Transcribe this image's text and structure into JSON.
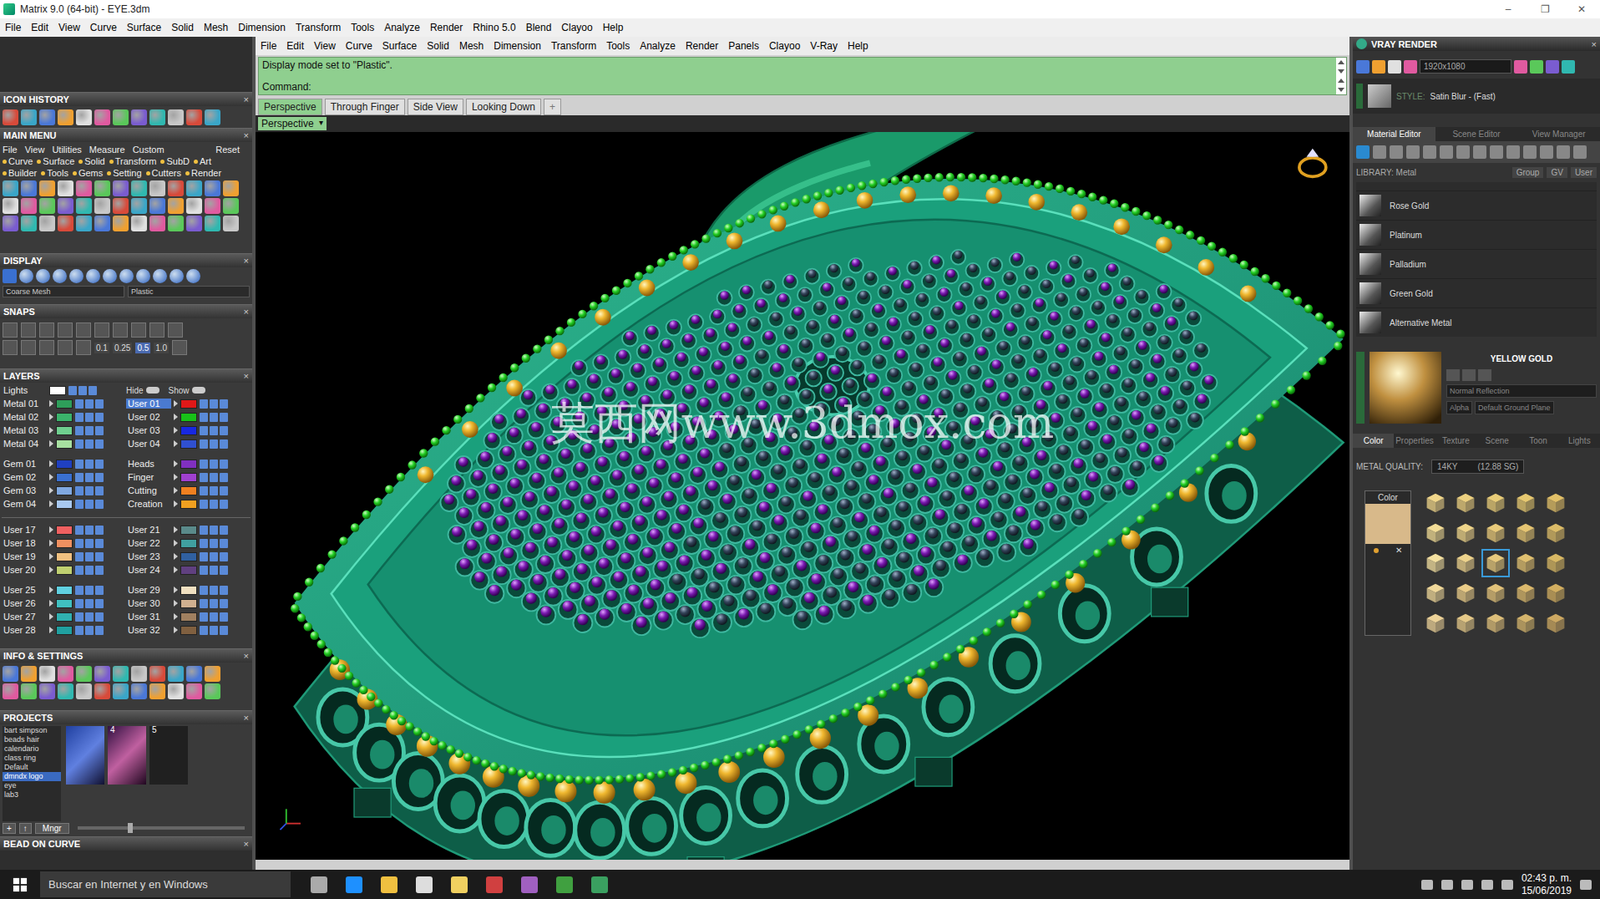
{
  "window": {
    "title": "Matrix 9.0 (64-bit) - EYE.3dm",
    "controls": [
      "–",
      "❐",
      "✕"
    ]
  },
  "menubar": [
    "File",
    "Edit",
    "View",
    "Curve",
    "Surface",
    "Solid",
    "Mesh",
    "Dimension",
    "Transform",
    "Tools",
    "Analyze",
    "Render",
    "Rhino 5.0",
    "Blend",
    "Clayoo",
    "Help"
  ],
  "panel_close": "×",
  "icon_history": {
    "title": "ICON HISTORY"
  },
  "main_menu": {
    "title": "MAIN MENU",
    "menus": [
      "File",
      "View",
      "Utilities",
      "Measure",
      "Custom"
    ],
    "reset": "Reset",
    "categories": [
      [
        "Curve",
        "Surface",
        "Solid",
        "Transform",
        "SubD",
        "Art"
      ],
      [
        "Builder",
        "Tools",
        "Gems",
        "Setting",
        "Cutters",
        "Render"
      ]
    ]
  },
  "display": {
    "title": "DISPLAY",
    "mesh": "Coarse Mesh",
    "mode": "Plastic"
  },
  "snaps": {
    "title": "SNAPS",
    "values": [
      {
        "label": "0.1",
        "selected": false
      },
      {
        "label": "0.25",
        "selected": false
      },
      {
        "label": "0.5",
        "selected": true
      },
      {
        "label": "1.0",
        "selected": false
      }
    ]
  },
  "layers": {
    "title": "LAYERS",
    "lights": "Lights",
    "hide": "Hide",
    "show": "Show",
    "groups": [
      [
        [
          {
            "name": "Metal 01",
            "color": "#2e9e5a",
            "selected": false
          },
          {
            "name": "User 01",
            "color": "#e01818",
            "selected": true
          }
        ],
        [
          {
            "name": "Metal 02",
            "color": "#3bb36b",
            "selected": false
          },
          {
            "name": "User 02",
            "color": "#18c018",
            "selected": false
          }
        ],
        [
          {
            "name": "Metal 03",
            "color": "#6fcf8f",
            "selected": false
          },
          {
            "name": "User 03",
            "color": "#1828e0",
            "selected": false
          }
        ],
        [
          {
            "name": "Metal 04",
            "color": "#a7e0a0",
            "selected": false
          },
          {
            "name": "User 04",
            "color": "#3050d0",
            "selected": false
          }
        ]
      ],
      [
        [
          {
            "name": "Gem 01",
            "color": "#2040c0",
            "selected": false
          },
          {
            "name": "Heads",
            "color": "#8030c0",
            "selected": false
          }
        ],
        [
          {
            "name": "Gem 02",
            "color": "#3a70d0",
            "selected": false
          },
          {
            "name": "Finger",
            "color": "#a040d0",
            "selected": false
          }
        ],
        [
          {
            "name": "Gem 03",
            "color": "#80a8e0",
            "selected": false
          },
          {
            "name": "Cutting",
            "color": "#f08020",
            "selected": false
          }
        ],
        [
          {
            "name": "Gem 04",
            "color": "#a8c8f0",
            "selected": false
          },
          {
            "name": "Creation",
            "color": "#f0a020",
            "selected": false
          }
        ]
      ],
      [
        [
          {
            "name": "User 17",
            "color": "#f06060",
            "selected": false
          },
          {
            "name": "User 21",
            "color": "#5a8a8a",
            "selected": false
          }
        ],
        [
          {
            "name": "User 18",
            "color": "#f09060",
            "selected": false
          },
          {
            "name": "User 22",
            "color": "#40a0a0",
            "selected": false
          }
        ],
        [
          {
            "name": "User 19",
            "color": "#f0c080",
            "selected": false
          },
          {
            "name": "User 23",
            "color": "#3060a0",
            "selected": false
          }
        ],
        [
          {
            "name": "User 20",
            "color": "#c0d070",
            "selected": false
          },
          {
            "name": "User 24",
            "color": "#604080",
            "selected": false
          }
        ]
      ],
      [
        [
          {
            "name": "User 25",
            "color": "#60d0e0",
            "selected": false
          },
          {
            "name": "User 29",
            "color": "#f0e0c0",
            "selected": false
          }
        ],
        [
          {
            "name": "User 26",
            "color": "#40c0c0",
            "selected": false
          },
          {
            "name": "User 30",
            "color": "#d0b090",
            "selected": false
          }
        ],
        [
          {
            "name": "User 27",
            "color": "#30b0b0",
            "selected": false
          },
          {
            "name": "User 31",
            "color": "#a08060",
            "selected": false
          }
        ],
        [
          {
            "name": "User 28",
            "color": "#20a0a0",
            "selected": false
          },
          {
            "name": "User 32",
            "color": "#806040",
            "selected": false
          }
        ]
      ]
    ]
  },
  "info": {
    "title": "INFO & SETTINGS"
  },
  "projects": {
    "title": "PROJECTS",
    "items": [
      {
        "label": "bart simpson",
        "selected": false
      },
      {
        "label": "beads hair",
        "selected": false
      },
      {
        "label": "calendario",
        "selected": false
      },
      {
        "label": "class ring",
        "selected": false
      },
      {
        "label": "Default",
        "selected": false
      },
      {
        "label": "dmndx logo",
        "selected": true
      },
      {
        "label": "eye",
        "selected": false
      },
      {
        "label": "lab3",
        "selected": false
      }
    ],
    "pages": [
      "4",
      "5"
    ],
    "manager": "Mngr",
    "add": "+",
    "up": "↑"
  },
  "bead": {
    "title": "BEAD ON CURVE"
  },
  "editor": {
    "menubar": [
      "File",
      "Edit",
      "View",
      "Curve",
      "Surface",
      "Solid",
      "Mesh",
      "Dimension",
      "Transform",
      "Tools",
      "Analyze",
      "Render",
      "Panels",
      "Clayoo",
      "V-Ray",
      "Help"
    ],
    "message": "Display mode set to \"Plastic\".",
    "prompt": "Command:",
    "tabs": [
      {
        "label": "Perspective",
        "selected": true
      },
      {
        "label": "Through Finger",
        "selected": false
      },
      {
        "label": "Side View",
        "selected": false
      },
      {
        "label": "Looking Down",
        "selected": false
      }
    ],
    "add_tab": "+",
    "viewport": {
      "label": "Perspective",
      "arrow": "▾",
      "watermark": "莫西网www.3dmox.com"
    }
  },
  "vray": {
    "title": "VRAY RENDER",
    "resolution": "1920x1080",
    "style_label": "STYLE:",
    "style": "Satin Blur - (Fast)",
    "tabs": [
      {
        "label": "Material Editor",
        "selected": true
      },
      {
        "label": "Scene Editor",
        "selected": false
      },
      {
        "label": "View Manager",
        "selected": false
      }
    ],
    "library": "LIBRARY: Metal",
    "library_buttons": [
      "Group",
      "GV",
      "User"
    ],
    "materials": [
      "Rose Gold",
      "Platinum",
      "Palladium",
      "Green Gold",
      "Alternative Metal"
    ],
    "preview_title": "YELLOW GOLD",
    "reflection": "Normal Reflection",
    "alpha": "Alpha",
    "ground": "Default Ground Plane",
    "subtabs": [
      {
        "label": "Color",
        "selected": true
      },
      {
        "label": "Properties",
        "selected": false
      },
      {
        "label": "Texture",
        "selected": false
      },
      {
        "label": "Scene",
        "selected": false
      },
      {
        "label": "Toon",
        "selected": false
      },
      {
        "label": "Lights",
        "selected": false
      }
    ],
    "quality_label": "METAL QUALITY:",
    "quality": "14KY",
    "quality_sg": "(12.88 SG)",
    "color_label": "Color",
    "color": "#d8b98a",
    "clear": "✕",
    "swatches": [
      {
        "color": "#f0d68a",
        "selected": false
      },
      {
        "color": "#ecd080",
        "selected": false
      },
      {
        "color": "#e8cc78",
        "selected": false
      },
      {
        "color": "#e6c870",
        "selected": false
      },
      {
        "color": "#e2c068",
        "selected": false
      },
      {
        "color": "#f2dc96",
        "selected": false
      },
      {
        "color": "#eed48a",
        "selected": false
      },
      {
        "color": "#e8ca7a",
        "selected": false
      },
      {
        "color": "#e4c472",
        "selected": false
      },
      {
        "color": "#dcbc68",
        "selected": false
      },
      {
        "color": "#f4e0a0",
        "selected": false
      },
      {
        "color": "#ecd28c",
        "selected": false
      },
      {
        "color": "#e6c87c",
        "selected": true
      },
      {
        "color": "#e0c070",
        "selected": false
      },
      {
        "color": "#d8b864",
        "selected": false
      },
      {
        "color": "#f0d89a",
        "selected": false
      },
      {
        "color": "#eacc88",
        "selected": false
      },
      {
        "color": "#e2c27a",
        "selected": false
      },
      {
        "color": "#dab86c",
        "selected": false
      },
      {
        "color": "#d2ae60",
        "selected": false
      },
      {
        "color": "#ecd298",
        "selected": false
      },
      {
        "color": "#e4c888",
        "selected": false
      },
      {
        "color": "#dcbe7a",
        "selected": false
      },
      {
        "color": "#d4b46c",
        "selected": false
      },
      {
        "color": "#cca862",
        "selected": false
      }
    ]
  },
  "taskbar": {
    "search": "Buscar en Internet y en Windows",
    "time": "02:43 p. m.",
    "date": "15/06/2019"
  }
}
